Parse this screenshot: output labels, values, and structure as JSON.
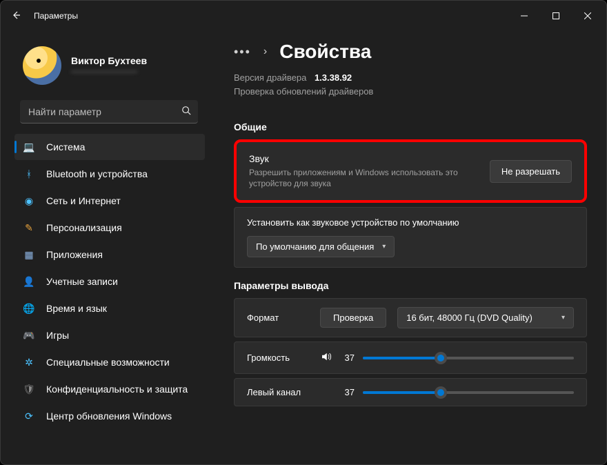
{
  "window": {
    "title": "Параметры"
  },
  "profile": {
    "name": "Виктор Бухтеев",
    "email": "————————"
  },
  "search": {
    "placeholder": "Найти параметр"
  },
  "nav": [
    {
      "id": "system",
      "label": "Система",
      "icon": "💻",
      "color": "#4cc2ff",
      "active": true
    },
    {
      "id": "bluetooth",
      "label": "Bluetooth и устройства",
      "icon": "ᚼ",
      "color": "#4cc2ff"
    },
    {
      "id": "network",
      "label": "Сеть и Интернет",
      "icon": "◉",
      "color": "#4cc2ff"
    },
    {
      "id": "personalization",
      "label": "Персонализация",
      "icon": "✎",
      "color": "#e8a33d"
    },
    {
      "id": "apps",
      "label": "Приложения",
      "icon": "▦",
      "color": "#8fb7e6"
    },
    {
      "id": "accounts",
      "label": "Учетные записи",
      "icon": "👤",
      "color": "#e07858"
    },
    {
      "id": "time",
      "label": "Время и язык",
      "icon": "🌐",
      "color": "#5aa0d8"
    },
    {
      "id": "gaming",
      "label": "Игры",
      "icon": "🎮",
      "color": "#8a8a8a"
    },
    {
      "id": "accessibility",
      "label": "Специальные возможности",
      "icon": "✲",
      "color": "#4cc2ff"
    },
    {
      "id": "privacy",
      "label": "Конфиденциальность и защита",
      "icon": "🛡",
      "color": "#8a8a8a"
    },
    {
      "id": "update",
      "label": "Центр обновления Windows",
      "icon": "⟳",
      "color": "#4cc2ff"
    }
  ],
  "page": {
    "title": "Свойства",
    "driver_label": "Версия драйвера",
    "driver_version": "1.3.38.92",
    "driver_check": "Проверка обновлений драйверов",
    "section_general": "Общие",
    "sound_title": "Звук",
    "sound_sub": "Разрешить приложениям и Windows использовать это устройство для звука",
    "deny_btn": "Не разрешать",
    "default_label": "Установить как звуковое устройство по умолчанию",
    "default_value": "По умолчанию для общения",
    "section_output": "Параметры вывода",
    "format_label": "Формат",
    "test_btn": "Проверка",
    "format_value": "16 бит, 48000 Гц (DVD Quality)",
    "volume_label": "Громкость",
    "volume_value": "37",
    "left_label": "Левый канал",
    "left_value": "37"
  }
}
